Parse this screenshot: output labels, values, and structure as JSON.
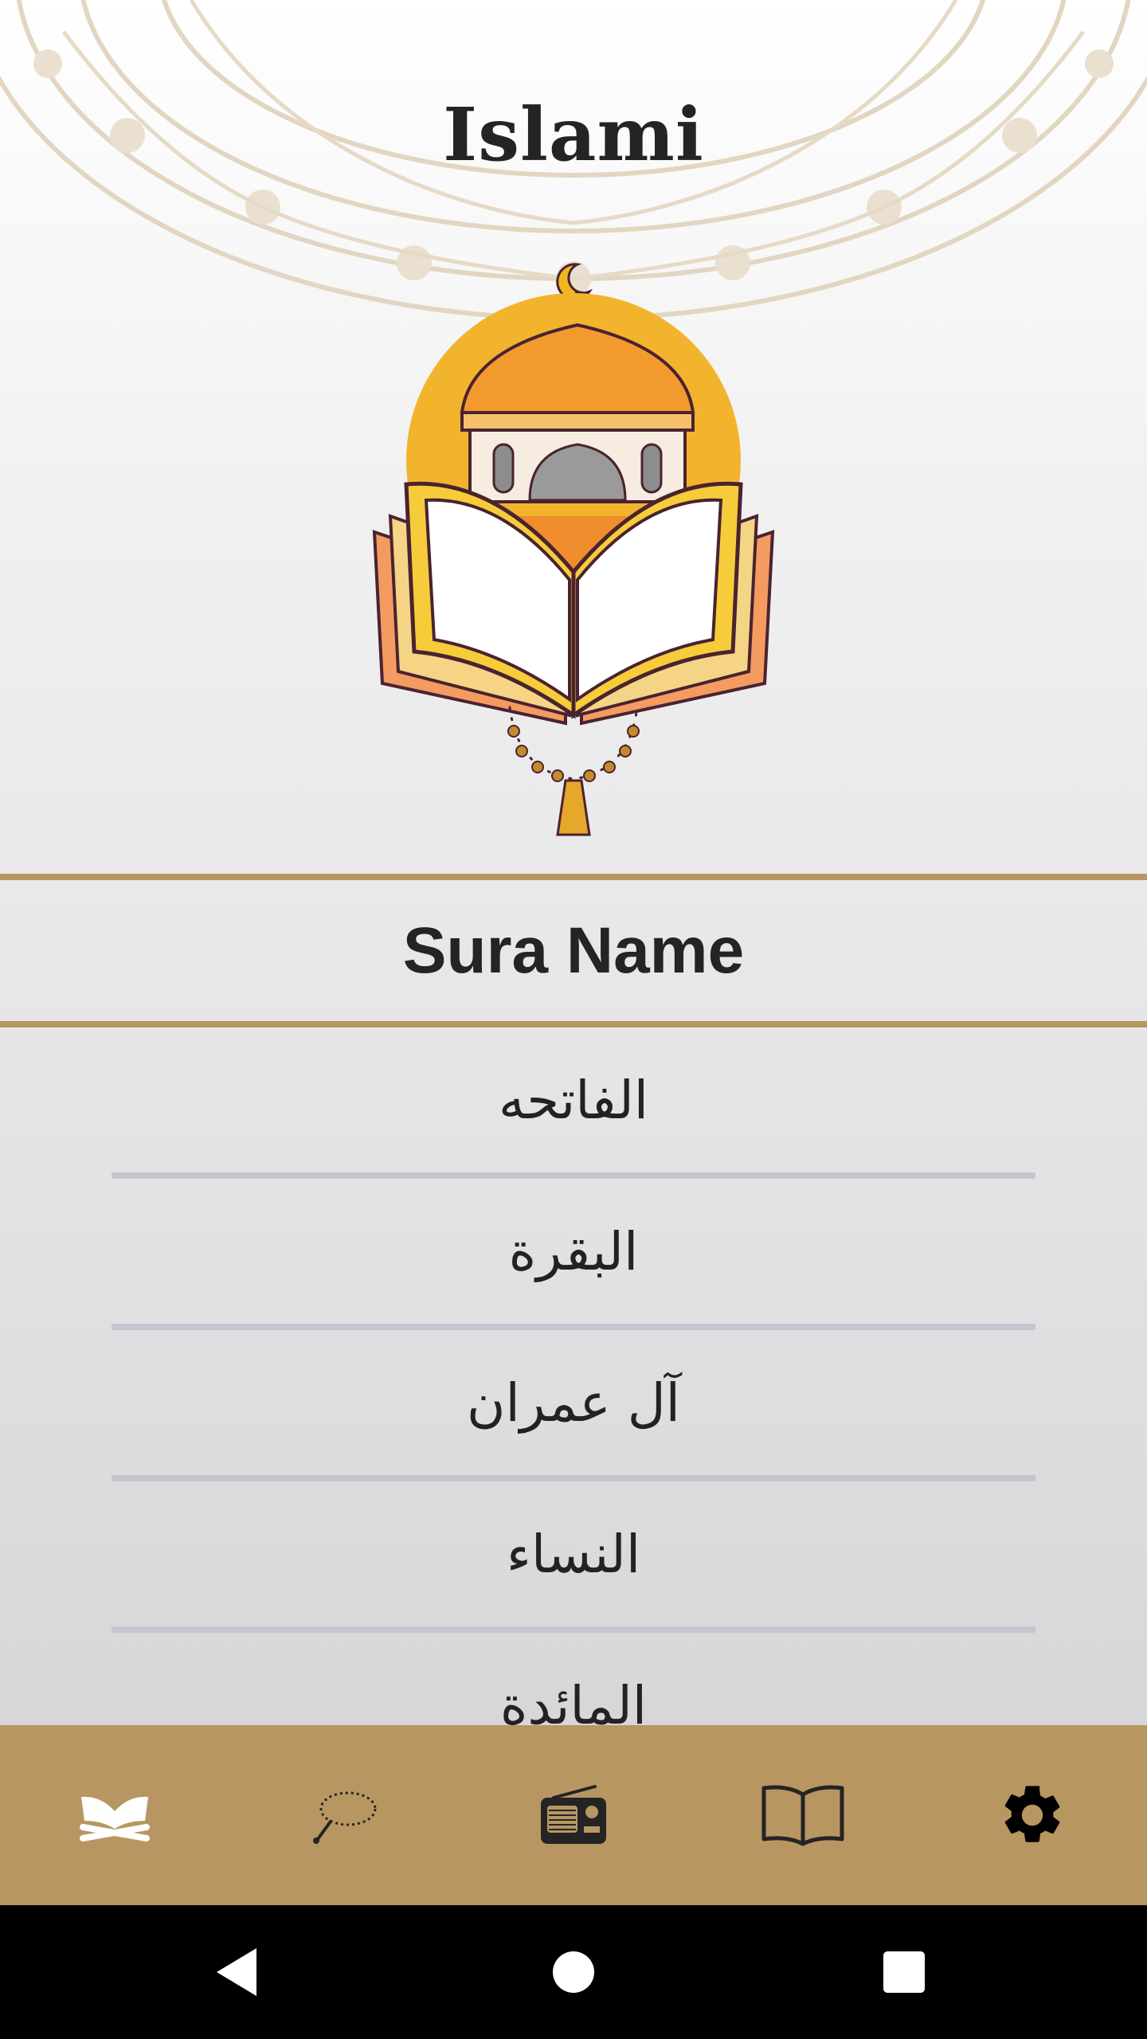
{
  "app": {
    "title": "Islami"
  },
  "header": {
    "label": "Sura Name"
  },
  "suras": [
    "الفاتحه",
    "البقرة",
    "آل عمران",
    "النساء",
    "المائدة"
  ],
  "bottom_nav": {
    "items": [
      {
        "icon": "quran-icon",
        "active": true
      },
      {
        "icon": "sebha-icon",
        "active": false
      },
      {
        "icon": "radio-icon",
        "active": false
      },
      {
        "icon": "hadeth-book-icon",
        "active": false
      },
      {
        "icon": "settings-gear-icon",
        "active": false
      }
    ]
  },
  "colors": {
    "accent": "#b89662",
    "text": "#242424",
    "divider": "#c7c4cf"
  }
}
